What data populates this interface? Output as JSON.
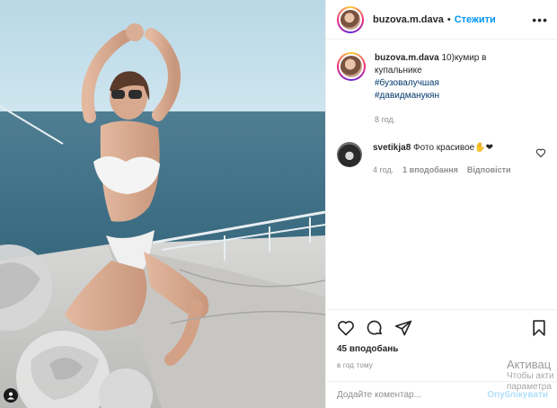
{
  "header": {
    "username": "buzova.m.dava",
    "separator": "•",
    "follow_label": "Стежити",
    "more_label": "•••"
  },
  "caption": {
    "username": "buzova.m.dava",
    "text": "10)кумир в купальнике",
    "hashtags": [
      "#бузовалучшая",
      "#давидманукян"
    ],
    "time": "8 год."
  },
  "comment": {
    "username": "svetikja8",
    "text": "Фото красивое✋❤",
    "time": "4 год.",
    "likes": "1 вподобання",
    "reply": "Відповісти"
  },
  "post": {
    "likes": "45 вподобань",
    "time": "в год тому"
  },
  "add_comment": {
    "placeholder": "Додайте коментар...",
    "publish": "Опублікувати"
  },
  "watermark": {
    "title": "Активац",
    "line1": "Чтобы акти",
    "line2": "параметра"
  },
  "icons": {
    "like": "heart-icon",
    "comment": "comment-icon",
    "share": "paper-plane-icon",
    "save": "bookmark-icon",
    "tag": "user-tag-icon"
  },
  "colors": {
    "accent": "#0095f6",
    "hashtag": "#00376b",
    "muted": "#8e8e8e"
  }
}
